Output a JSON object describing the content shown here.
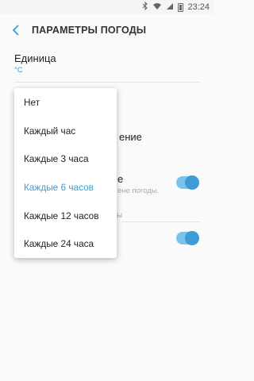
{
  "status_bar": {
    "time": "23:24"
  },
  "header": {
    "title": "ПАРАМЕТРЫ ПОГОДЫ"
  },
  "unit_setting": {
    "title": "Единица",
    "value": "°C"
  },
  "partial_labels": {
    "row2_tail": "ение",
    "row3_tail": "e",
    "row3_sub_tail": "ене погоды.",
    "section_tail": "ы"
  },
  "dropdown": {
    "items": [
      "Нет",
      "Каждый час",
      "Каждые 3 часа",
      "Каждые 6 часов",
      "Каждые 12 часов",
      "Каждые 24 часа"
    ],
    "selected_index": 3
  },
  "colors": {
    "accent": "#3d9bd6",
    "toggle_track": "#7ac2ea"
  }
}
